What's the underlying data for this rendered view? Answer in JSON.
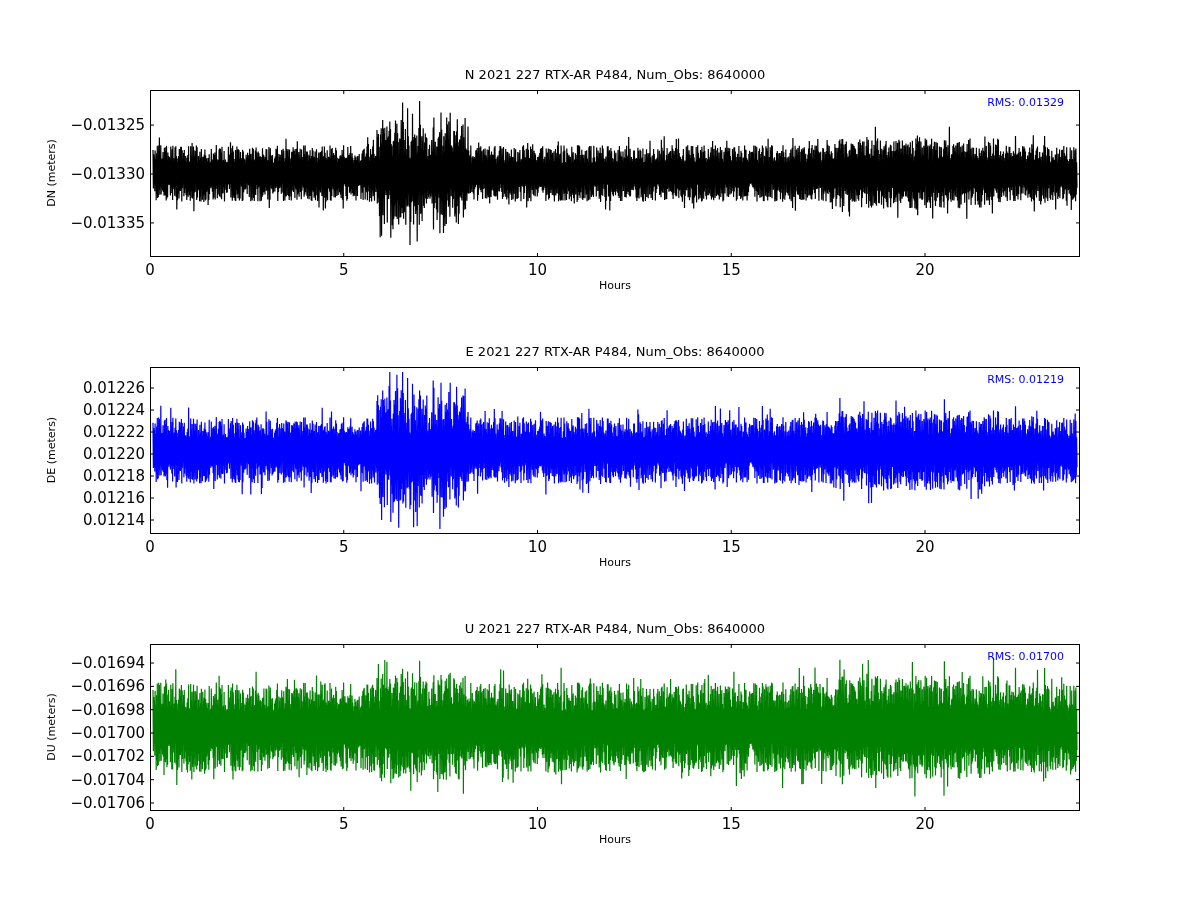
{
  "panels": [
    {
      "title": "N 2021 227 RTX-AR  P484, Num_Obs: 8640000",
      "ylabel": "DN (meters)",
      "xlabel": "Hours",
      "rms": "RMS:  0.01329",
      "color": "#000000",
      "yticks": [
        "−0.01325",
        "−0.01330",
        "−0.01335"
      ],
      "xticks": [
        "0",
        "5",
        "10",
        "15",
        "20"
      ]
    },
    {
      "title": "E 2021 227 RTX-AR  P484, Num_Obs: 8640000",
      "ylabel": "DE (meters)",
      "xlabel": "Hours",
      "rms": "RMS:  0.01219",
      "color": "#0000ff",
      "yticks": [
        "0.01226",
        "0.01224",
        "0.01222",
        "0.01220",
        "0.01218",
        "0.01216",
        "0.01214"
      ],
      "xticks": [
        "0",
        "5",
        "10",
        "15",
        "20"
      ]
    },
    {
      "title": "U 2021 227 RTX-AR  P484, Num_Obs: 8640000",
      "ylabel": "DU (meters)",
      "xlabel": "Hours",
      "rms": "RMS:  0.01700",
      "color": "#008000",
      "yticks": [
        "−0.01694",
        "−0.01696",
        "−0.01698",
        "−0.01700",
        "−0.01702",
        "−0.01704",
        "−0.01706"
      ],
      "xticks": [
        "0",
        "5",
        "10",
        "15",
        "20"
      ]
    }
  ]
}
